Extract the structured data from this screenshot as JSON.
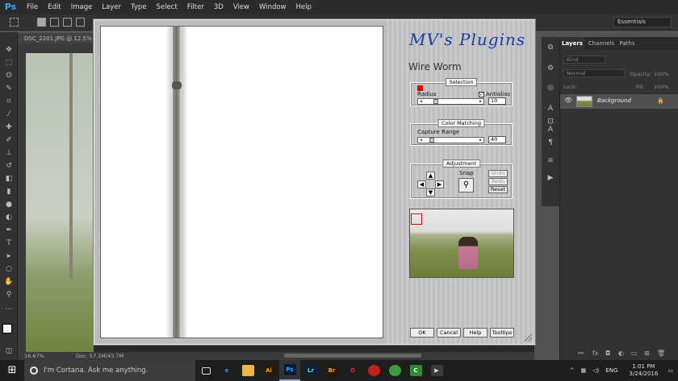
{
  "app": {
    "logo": "Ps"
  },
  "menu": [
    "File",
    "Edit",
    "Image",
    "Layer",
    "Type",
    "Select",
    "Filter",
    "3D",
    "View",
    "Window",
    "Help"
  ],
  "options_bar": {
    "workspace": "Essentials"
  },
  "document": {
    "tab_title": "DSC_2201.JPG @ 12.5% (R",
    "zoom": "16.67%",
    "doc_size": "Doc: 57.1M/43.7M"
  },
  "plugin": {
    "logo": "MV's Plugins",
    "title": "Wire Worm",
    "selection": {
      "title": "Selection",
      "radius_label": "Radius",
      "antialias_label": "Antialias",
      "antialias_checked": true,
      "radius_value": "10",
      "radius_fraction": 0.2
    },
    "color_matching": {
      "title": "Color Matching",
      "capture_label": "Capture Range",
      "capture_value": "40",
      "capture_fraction": 0.12
    },
    "adjustment": {
      "title": "Adjustment",
      "snap_label": "Snap",
      "undo": "Undo",
      "redo": "Redo",
      "reset": "Reset"
    },
    "buttons": {
      "ok": "OK",
      "cancel": "Cancel",
      "help": "Help",
      "tooltips": "Tooltips"
    }
  },
  "layers_panel": {
    "tabs": [
      "Layers",
      "Channels",
      "Paths"
    ],
    "filter_kind": "Kind",
    "blend_mode": "Normal",
    "opacity_label": "Opacity:",
    "opacity_value": "100%",
    "lock_label": "Lock:",
    "fill_label": "Fill:",
    "fill_value": "100%",
    "layer_name": "Background"
  },
  "taskbar": {
    "search_placeholder": "I'm Cortana. Ask me anything.",
    "language": "ENG",
    "time": "1:01 PM",
    "date": "3/24/2016"
  },
  "apps": [
    {
      "icon": "task-view-icon",
      "label": "",
      "color": "#1e1e1e",
      "text": "#fff"
    },
    {
      "icon": "edge-icon",
      "label": "e",
      "color": "#1e1e1e",
      "text": "#3a8fe6"
    },
    {
      "icon": "file-explorer-icon",
      "label": "",
      "color": "#e8b84a",
      "text": "#fff"
    },
    {
      "icon": "illustrator-icon",
      "label": "Ai",
      "color": "#2b1a06",
      "text": "#ff9a00"
    },
    {
      "icon": "photoshop-icon",
      "label": "Ps",
      "color": "#061e3a",
      "text": "#31a8ff"
    },
    {
      "icon": "lightroom-icon",
      "label": "Lr",
      "color": "#0b2236",
      "text": "#8bc7f0"
    },
    {
      "icon": "bridge-icon",
      "label": "Br",
      "color": "#2a1706",
      "text": "#e8a060"
    },
    {
      "icon": "opera-icon",
      "label": "O",
      "color": "#1e1e1e",
      "text": "#e3232f"
    },
    {
      "icon": "app-red-icon",
      "label": "",
      "color": "#c0211f",
      "text": "#fff"
    },
    {
      "icon": "app-green-icon",
      "label": "",
      "color": "#3a9d3a",
      "text": "#fff"
    },
    {
      "icon": "camtasia-icon",
      "label": "C",
      "color": "#2e8b2e",
      "text": "#fff"
    },
    {
      "icon": "media-icon",
      "label": "▶",
      "color": "#3a3a3a",
      "text": "#ddd"
    }
  ]
}
